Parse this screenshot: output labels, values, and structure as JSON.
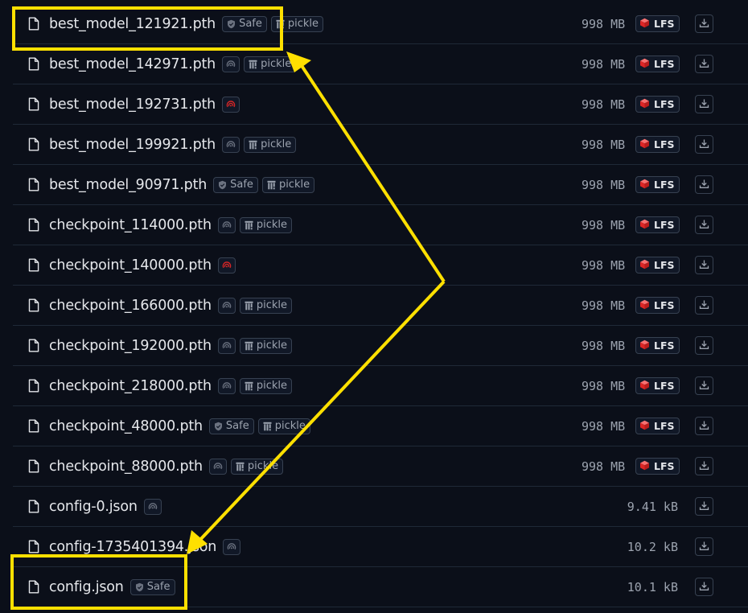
{
  "files": [
    {
      "name": "best_model_121921.pth",
      "badges": [
        "Safe",
        "pickle"
      ],
      "scan": "none",
      "size": "998 MB",
      "lfs": "LFS"
    },
    {
      "name": "best_model_142971.pth",
      "badges": [
        "pickle"
      ],
      "scan": "gray",
      "size": "998 MB",
      "lfs": "LFS"
    },
    {
      "name": "best_model_192731.pth",
      "badges": [],
      "scan": "red",
      "size": "998 MB",
      "lfs": "LFS"
    },
    {
      "name": "best_model_199921.pth",
      "badges": [
        "pickle"
      ],
      "scan": "gray",
      "size": "998 MB",
      "lfs": "LFS"
    },
    {
      "name": "best_model_90971.pth",
      "badges": [
        "Safe",
        "pickle"
      ],
      "scan": "none",
      "size": "998 MB",
      "lfs": "LFS"
    },
    {
      "name": "checkpoint_114000.pth",
      "badges": [
        "pickle"
      ],
      "scan": "gray",
      "size": "998 MB",
      "lfs": "LFS"
    },
    {
      "name": "checkpoint_140000.pth",
      "badges": [],
      "scan": "red",
      "size": "998 MB",
      "lfs": "LFS"
    },
    {
      "name": "checkpoint_166000.pth",
      "badges": [
        "pickle"
      ],
      "scan": "gray",
      "size": "998 MB",
      "lfs": "LFS"
    },
    {
      "name": "checkpoint_192000.pth",
      "badges": [
        "pickle"
      ],
      "scan": "gray",
      "size": "998 MB",
      "lfs": "LFS"
    },
    {
      "name": "checkpoint_218000.pth",
      "badges": [
        "pickle"
      ],
      "scan": "gray",
      "size": "998 MB",
      "lfs": "LFS"
    },
    {
      "name": "checkpoint_48000.pth",
      "badges": [
        "Safe",
        "pickle"
      ],
      "scan": "none",
      "size": "998 MB",
      "lfs": "LFS"
    },
    {
      "name": "checkpoint_88000.pth",
      "badges": [
        "pickle"
      ],
      "scan": "gray",
      "size": "998 MB",
      "lfs": "LFS"
    },
    {
      "name": "config-0.json",
      "badges": [],
      "scan": "gray",
      "size": "9.41 kB",
      "lfs": ""
    },
    {
      "name": "config-1735401394.json",
      "badges": [],
      "scan": "gray",
      "size": "10.2 kB",
      "lfs": ""
    },
    {
      "name": "config.json",
      "badges": [
        "Safe"
      ],
      "scan": "none",
      "size": "10.1 kB",
      "lfs": ""
    }
  ],
  "icons": {
    "file": "file-icon",
    "safe": "shield-icon",
    "pickle": "pickle-icon",
    "scan": "scan-status-icon",
    "lfs": "lfs-cube-icon",
    "download": "download-icon"
  },
  "colors": {
    "background": "#0b0f19",
    "row_border": "#1f2937",
    "badge_border": "#374151",
    "text": "#e5e7eb",
    "muted": "#9ca3af",
    "lfs_red": "#ef4444",
    "scan_red": "#dc2626",
    "highlight": "#ffe000"
  }
}
